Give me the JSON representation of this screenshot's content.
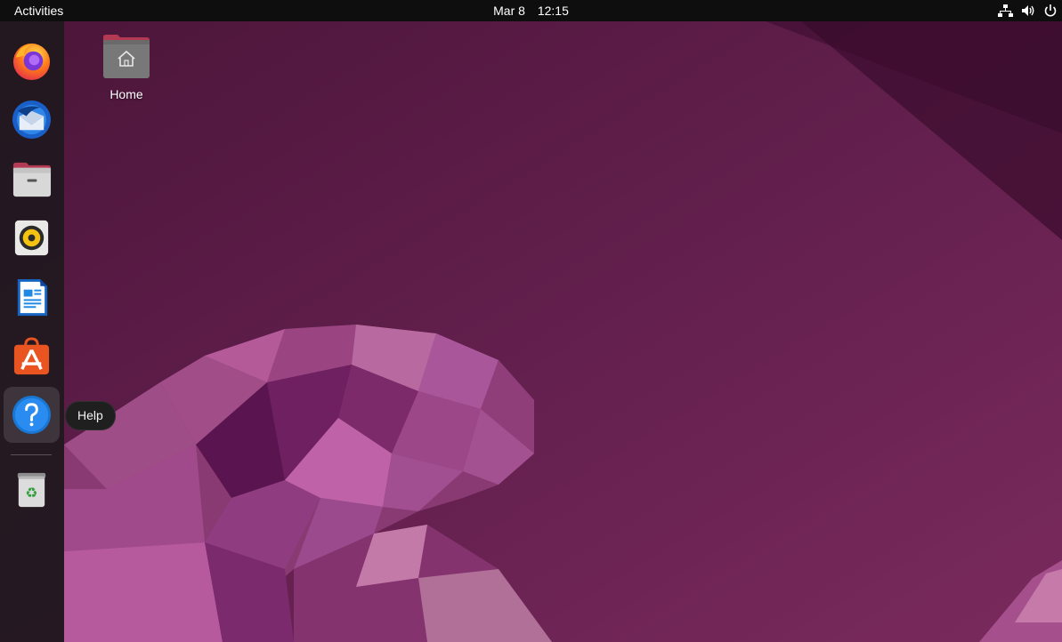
{
  "topbar": {
    "activities_label": "Activities",
    "date": "Mar 8",
    "time": "12:15",
    "tray_icons": [
      "network-icon",
      "volume-icon",
      "power-icon"
    ]
  },
  "dock": {
    "items": [
      {
        "name": "Firefox",
        "icon": "firefox-icon"
      },
      {
        "name": "Thunderbird Mail",
        "icon": "thunderbird-icon"
      },
      {
        "name": "Files",
        "icon": "files-icon"
      },
      {
        "name": "Rhythmbox",
        "icon": "rhythmbox-icon"
      },
      {
        "name": "LibreOffice Writer",
        "icon": "libreoffice-writer-icon"
      },
      {
        "name": "Ubuntu Software",
        "icon": "ubuntu-software-icon"
      },
      {
        "name": "Help",
        "icon": "help-icon",
        "hovered": true
      },
      {
        "name": "Trash",
        "icon": "trash-icon"
      }
    ]
  },
  "tooltip": {
    "text": "Help"
  },
  "desktop": {
    "icons": [
      {
        "label": "Home",
        "icon": "home-folder-icon"
      }
    ]
  },
  "colors": {
    "topbar": "#0e0e0e",
    "dock": "#20181e",
    "wallpaper_dark": "#3a0c2c",
    "wallpaper_mid": "#6b1f55",
    "wallpaper_light": "#a0487f"
  }
}
